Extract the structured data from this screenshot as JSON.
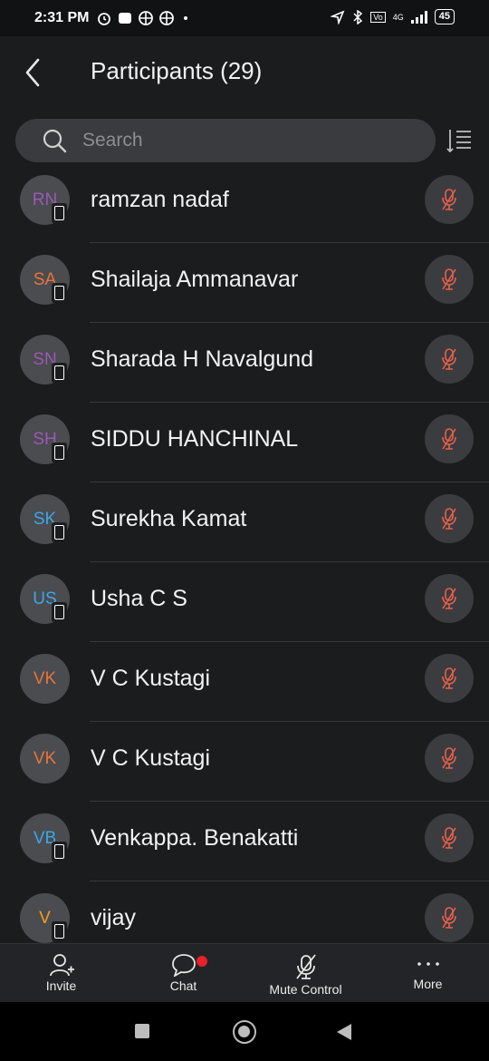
{
  "status_bar": {
    "time": "2:31 PM",
    "battery": "45",
    "network": "4G"
  },
  "header": {
    "title": "Participants (29)"
  },
  "search": {
    "placeholder": "Search"
  },
  "participants": [
    {
      "initials": "RN",
      "name": "ramzan nadaf",
      "color": "#9b59b6",
      "phone": true
    },
    {
      "initials": "SA",
      "name": "Shailaja Ammanavar",
      "color": "#e8743b",
      "phone": true
    },
    {
      "initials": "SN",
      "name": "Sharada H Navalgund",
      "color": "#9b59b6",
      "phone": true
    },
    {
      "initials": "SH",
      "name": "SIDDU HANCHINAL",
      "color": "#9b59b6",
      "phone": true
    },
    {
      "initials": "SK",
      "name": "Surekha Kamat",
      "color": "#3ea6e6",
      "phone": true
    },
    {
      "initials": "US",
      "name": "Usha C S",
      "color": "#3ea6e6",
      "phone": true
    },
    {
      "initials": "VK",
      "name": "V C Kustagi",
      "color": "#e8743b",
      "phone": false
    },
    {
      "initials": "VK",
      "name": "V C Kustagi",
      "color": "#e8743b",
      "phone": false
    },
    {
      "initials": "VB",
      "name": "Venkappa. Benakatti",
      "color": "#3ea6e6",
      "phone": true
    },
    {
      "initials": "V",
      "name": "vijay",
      "color": "#f0a020",
      "phone": true
    }
  ],
  "bottom_tabs": {
    "invite": "Invite",
    "chat": "Chat",
    "mute_control": "Mute Control",
    "more": "More"
  },
  "colors": {
    "muted_mic": "#e8604c",
    "chat_badge": "#e8202a"
  }
}
